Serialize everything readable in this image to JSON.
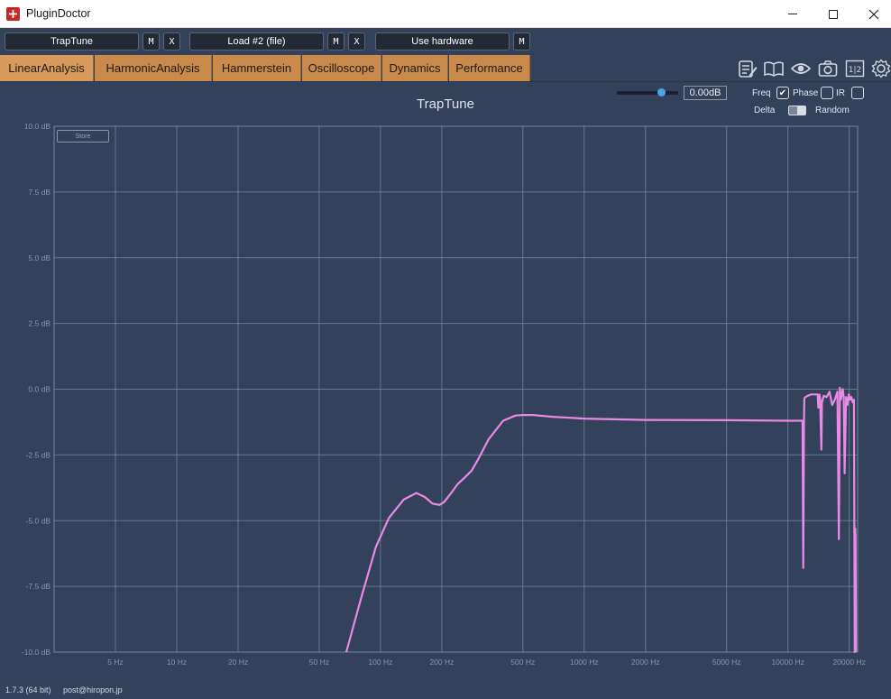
{
  "window": {
    "title": "PluginDoctor"
  },
  "slots": [
    {
      "label": "TrapTune",
      "buttons": [
        "M",
        "X"
      ]
    },
    {
      "label": "Load #2 (file)",
      "buttons": [
        "M",
        "X"
      ]
    },
    {
      "label": "Use hardware",
      "buttons": [
        "M"
      ]
    }
  ],
  "tabs": [
    {
      "label": "LinearAnalysis",
      "active": true
    },
    {
      "label": "HarmonicAnalysis",
      "active": false
    },
    {
      "label": "Hammerstein",
      "active": false
    },
    {
      "label": "Oscilloscope",
      "active": false
    },
    {
      "label": "Dynamics",
      "active": false
    },
    {
      "label": "Performance",
      "active": false
    }
  ],
  "toolbar_icons": [
    "notes-icon",
    "book-icon",
    "eye-icon",
    "camera-icon",
    "split-view-icon",
    "gear-icon"
  ],
  "toolbar_split_label": "1|2",
  "controls": {
    "gain_value": "0.00dB",
    "gain_slider_fraction": 0.72,
    "freq_label": "Freq",
    "freq_checked": true,
    "phase_label": "Phase",
    "phase_checked": false,
    "ir_label": "IR",
    "ir_checked": false,
    "delta_label": "Delta",
    "random_label": "Random",
    "delta_random_toggle": "delta"
  },
  "store_label": "Store",
  "chart_data": {
    "type": "line",
    "title": "TrapTune",
    "x_scale": "log",
    "xlim": [
      2.5,
      22000
    ],
    "ylim": [
      -10,
      10
    ],
    "grid": true,
    "y_ticks": [
      {
        "value": 10,
        "label": "10.0 dB"
      },
      {
        "value": 7.5,
        "label": "7.5 dB"
      },
      {
        "value": 5,
        "label": "5.0 dB"
      },
      {
        "value": 2.5,
        "label": "2.5 dB"
      },
      {
        "value": 0,
        "label": "0.0 dB"
      },
      {
        "value": -2.5,
        "label": "-2.5 dB"
      },
      {
        "value": -5,
        "label": "-5.0 dB"
      },
      {
        "value": -7.5,
        "label": "-7.5 dB"
      },
      {
        "value": -10,
        "label": "-10.0 dB"
      }
    ],
    "x_ticks": [
      {
        "value": 5,
        "label": "5 Hz"
      },
      {
        "value": 10,
        "label": "10 Hz"
      },
      {
        "value": 20,
        "label": "20 Hz"
      },
      {
        "value": 50,
        "label": "50 Hz"
      },
      {
        "value": 100,
        "label": "100 Hz"
      },
      {
        "value": 200,
        "label": "200 Hz"
      },
      {
        "value": 500,
        "label": "500 Hz"
      },
      {
        "value": 1000,
        "label": "1000 Hz"
      },
      {
        "value": 2000,
        "label": "2000 Hz"
      },
      {
        "value": 5000,
        "label": "5000 Hz"
      },
      {
        "value": 10000,
        "label": "10000 Hz"
      },
      {
        "value": 20000,
        "label": "20000 Hz"
      }
    ],
    "series": [
      {
        "color": "#e98ae6",
        "x": [
          68,
          80,
          95,
          110,
          130,
          150,
          165,
          180,
          195,
          205,
          220,
          240,
          260,
          280,
          300,
          340,
          400,
          460,
          500,
          560,
          700,
          1000,
          2000,
          5000,
          10000,
          11500,
          11800,
          11900,
          12000,
          12050,
          12200,
          12500,
          13000,
          13500,
          14000,
          14100,
          14300,
          14400,
          14600,
          14700,
          15000,
          15500,
          16000,
          16500,
          17000,
          17500,
          17800,
          18000,
          18200,
          18400,
          18600,
          18800,
          19000,
          19300,
          19600,
          19900,
          20200,
          20500,
          20800,
          21100,
          21300,
          21400,
          21500,
          21600
        ],
        "y": [
          -10,
          -8,
          -6,
          -4.9,
          -4.2,
          -3.95,
          -4.1,
          -4.35,
          -4.4,
          -4.3,
          -4.0,
          -3.6,
          -3.35,
          -3.1,
          -2.7,
          -1.9,
          -1.2,
          -1.0,
          -0.98,
          -0.98,
          -1.05,
          -1.12,
          -1.17,
          -1.18,
          -1.2,
          -1.2,
          -1.2,
          -6.8,
          -1.2,
          -0.35,
          -0.3,
          -0.25,
          -0.2,
          -0.2,
          -0.2,
          -0.7,
          -0.2,
          -0.35,
          -2.3,
          -0.5,
          -0.25,
          -0.3,
          -0.1,
          -0.6,
          -0.4,
          -0.1,
          -5.7,
          0.05,
          -0.4,
          -0.2,
          0.0,
          -0.3,
          -3.2,
          -0.3,
          -0.6,
          -0.2,
          -0.4,
          -0.3,
          -0.5,
          -0.4,
          -10,
          -5.3,
          -5.6,
          -10
        ]
      }
    ]
  },
  "footer": {
    "version": "1.7.3 (64 bit)",
    "email": "post@hiropon.jp"
  }
}
